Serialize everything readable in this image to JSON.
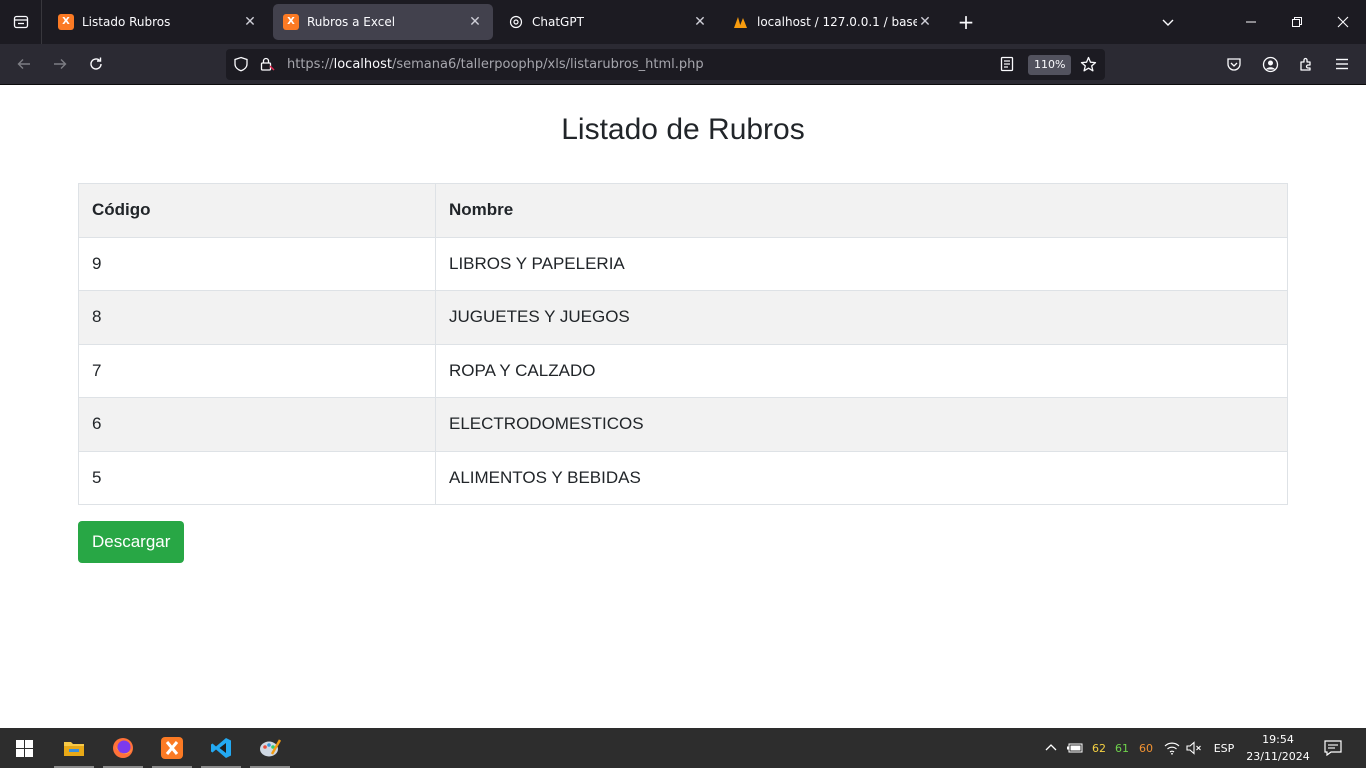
{
  "browser": {
    "tabs": [
      {
        "title": "Listado Rubros",
        "favicon": "xampp-icon",
        "active": false
      },
      {
        "title": "Rubros a Excel",
        "favicon": "xampp-icon",
        "active": true
      },
      {
        "title": "ChatGPT",
        "favicon": "chatgpt-icon",
        "active": false
      },
      {
        "title": "localhost / 127.0.0.1 / basepoo2",
        "favicon": "phpmyadmin-icon",
        "active": false
      }
    ],
    "url_prefix": "https://",
    "url_host": "localhost",
    "url_path": "/semana6/tallerpoophp/xls/listarubros_html.php",
    "zoom": "110%"
  },
  "page": {
    "title": "Listado de Rubros",
    "table": {
      "headers": [
        "Código",
        "Nombre"
      ],
      "rows": [
        [
          "9",
          "LIBROS Y PAPELERIA"
        ],
        [
          "8",
          "JUGUETES Y JUEGOS"
        ],
        [
          "7",
          "ROPA Y CALZADO"
        ],
        [
          "6",
          "ELECTRODOMESTICOS"
        ],
        [
          "5",
          "ALIMENTOS Y BEBIDAS"
        ]
      ]
    },
    "download_label": "Descargar",
    "button_color": "#28a745"
  },
  "taskbar": {
    "temps": [
      "62",
      "61",
      "60"
    ],
    "language": "ESP",
    "time": "19:54",
    "date": "23/11/2024"
  }
}
